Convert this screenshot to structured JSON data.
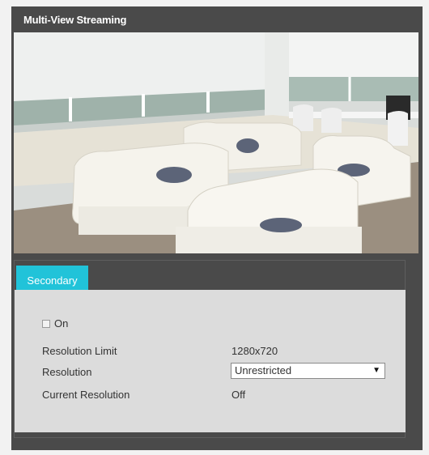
{
  "panel": {
    "title": "Multi-View Streaming"
  },
  "tabs": [
    {
      "label": "Secondary",
      "active": true
    }
  ],
  "form": {
    "on_checkbox": {
      "label": "On",
      "checked": false
    },
    "resolution_limit": {
      "label": "Resolution Limit",
      "value": "1280x720"
    },
    "resolution": {
      "label": "Resolution",
      "selected": "Unrestricted"
    },
    "current_resolution": {
      "label": "Current Resolution",
      "value": "Off"
    }
  },
  "colors": {
    "panel_bg": "#4a4a4a",
    "tab_accent": "#21c3d9",
    "content_bg": "#dcdcdc"
  },
  "icons": {
    "dropdown": "chevron-down-icon"
  }
}
